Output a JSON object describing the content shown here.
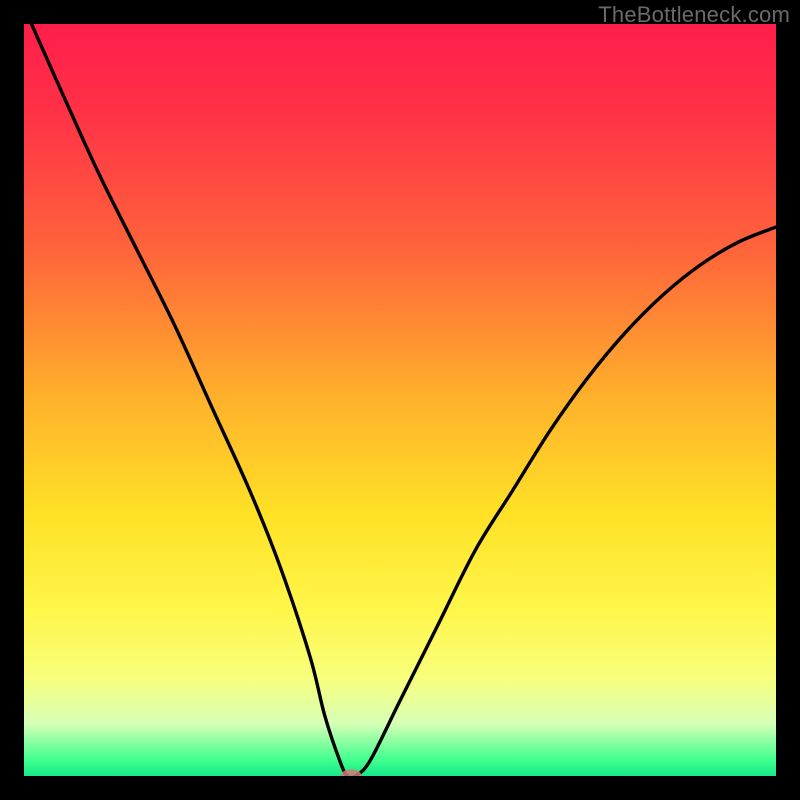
{
  "watermark": "TheBottleneck.com",
  "colors": {
    "gradient_stops": [
      {
        "offset": 0.0,
        "color": "#ff1e4b"
      },
      {
        "offset": 0.12,
        "color": "#ff3246"
      },
      {
        "offset": 0.3,
        "color": "#ff643b"
      },
      {
        "offset": 0.5,
        "color": "#ffb22b"
      },
      {
        "offset": 0.65,
        "color": "#ffe126"
      },
      {
        "offset": 0.78,
        "color": "#fff64a"
      },
      {
        "offset": 0.87,
        "color": "#f8ff7d"
      },
      {
        "offset": 0.93,
        "color": "#d7ffb6"
      },
      {
        "offset": 0.98,
        "color": "#3dff8d"
      },
      {
        "offset": 1.0,
        "color": "#16e788"
      }
    ],
    "curve_stroke": "#000000",
    "marker_fill": "#cf7a74",
    "frame": "#000000"
  },
  "chart_data": {
    "type": "line",
    "title": "",
    "xlabel": "",
    "ylabel": "",
    "xlim": [
      0,
      100
    ],
    "ylim": [
      0,
      100
    ],
    "grid": false,
    "legend": false,
    "series": [
      {
        "name": "bottleneck-curve",
        "x": [
          1,
          5,
          10,
          15,
          20,
          25,
          30,
          34,
          38,
          40,
          42,
          43,
          44,
          46,
          50,
          55,
          60,
          65,
          70,
          75,
          80,
          85,
          90,
          95,
          100
        ],
        "y": [
          100,
          91,
          80,
          70,
          60,
          49,
          38,
          28,
          16,
          8,
          2,
          0,
          0,
          2,
          10,
          20,
          30,
          38,
          46,
          53,
          59,
          64,
          68,
          71,
          73
        ]
      }
    ],
    "marker": {
      "x": 43.5,
      "y": 0,
      "rx_pct": 1.4,
      "ry_pct": 0.9
    }
  }
}
